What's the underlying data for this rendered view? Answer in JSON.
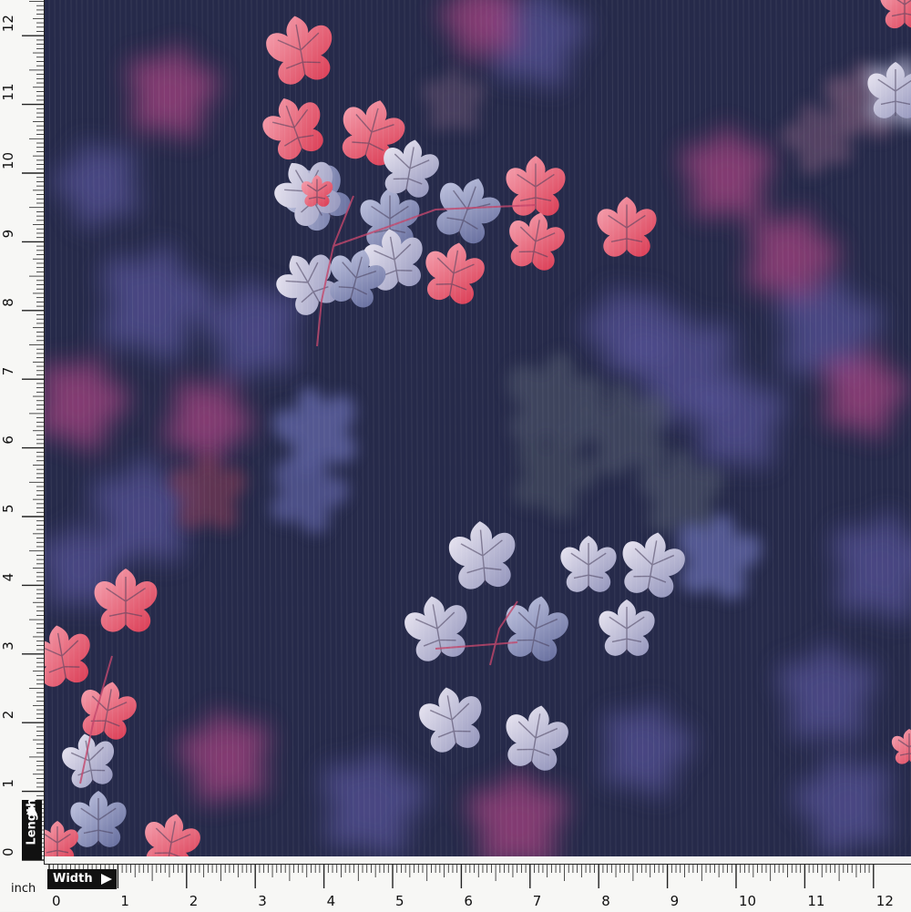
{
  "swatch": {
    "background_color": "#262a4a",
    "leaf_colors": {
      "pink": "#e2566e",
      "lavender": "#d9d4e8",
      "blue_gray": "#8f95c0",
      "blurred_purple": "#5d5aa3",
      "blurred_pink": "#b8468a"
    },
    "motif": "scattered pink and lavender leaf clusters on navy"
  },
  "ruler": {
    "unit": "inch",
    "horizontal_label": "Width",
    "vertical_label": "Length",
    "horizontal_ticks": [
      "0",
      "1",
      "2",
      "3",
      "4",
      "5",
      "6",
      "7",
      "8",
      "9",
      "10",
      "11",
      "12"
    ],
    "vertical_ticks": [
      "0",
      "1",
      "2",
      "3",
      "4",
      "5",
      "6",
      "7",
      "8",
      "9",
      "10",
      "11",
      "12"
    ]
  }
}
